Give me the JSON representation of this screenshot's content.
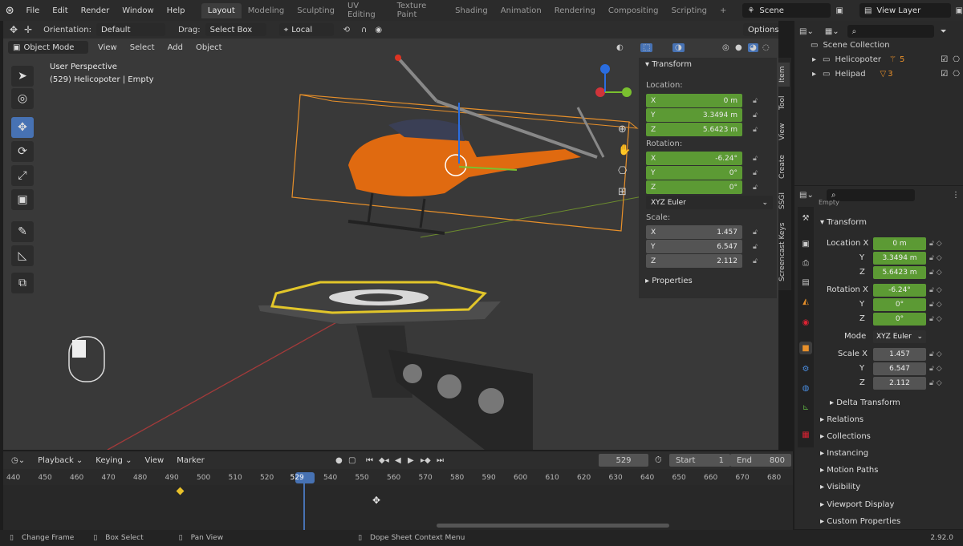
{
  "topbar": {
    "menus": [
      "File",
      "Edit",
      "Render",
      "Window",
      "Help"
    ],
    "workspaces": [
      "Layout",
      "Modeling",
      "Sculpting",
      "UV Editing",
      "Texture Paint",
      "Shading",
      "Animation",
      "Rendering",
      "Compositing",
      "Scripting"
    ],
    "add_tab": "+",
    "scene": "Scene",
    "view_layer": "View Layer"
  },
  "header": {
    "orientation_label": "Orientation:",
    "orientation_value": "Default",
    "drag_label": "Drag:",
    "drag_value": "Select Box",
    "pivot_value": "Local",
    "options": "Options",
    "mode": "Object Mode",
    "view_menus": [
      "View",
      "Select",
      "Add",
      "Object"
    ]
  },
  "viewport": {
    "perspective": "User Perspective",
    "object_info": "(529) Helicopoter | Empty"
  },
  "npanel": {
    "section": "Transform",
    "location_label": "Location:",
    "location": [
      {
        "axis": "X",
        "value": "0 m"
      },
      {
        "axis": "Y",
        "value": "3.3494 m"
      },
      {
        "axis": "Z",
        "value": "5.6423 m"
      }
    ],
    "rotation_label": "Rotation:",
    "rotation": [
      {
        "axis": "X",
        "value": "-6.24°"
      },
      {
        "axis": "Y",
        "value": "0°"
      },
      {
        "axis": "Z",
        "value": "0°"
      }
    ],
    "rotation_mode": "XYZ Euler",
    "scale_label": "Scale:",
    "scale": [
      {
        "axis": "X",
        "value": "1.457"
      },
      {
        "axis": "Y",
        "value": "6.547"
      },
      {
        "axis": "Z",
        "value": "2.112"
      }
    ],
    "properties": "Properties",
    "tabs": [
      "Item",
      "Tool",
      "View",
      "Create",
      "SSGI",
      "Screencast Keys"
    ]
  },
  "outliner": {
    "root": "Scene Collection",
    "items": [
      {
        "name": "Helicopoter",
        "badge": "5"
      },
      {
        "name": "Helipad",
        "badge": "3"
      }
    ]
  },
  "properties": {
    "obj_name": "Empty",
    "section": "Transform",
    "location_labels": [
      "Location X",
      "Y",
      "Z"
    ],
    "location_values": [
      "0 m",
      "3.3494 m",
      "5.6423 m"
    ],
    "rotation_labels": [
      "Rotation X",
      "Y",
      "Z"
    ],
    "rotation_values": [
      "-6.24°",
      "0°",
      "0°"
    ],
    "mode_label": "Mode",
    "mode_value": "XYZ Euler",
    "scale_labels": [
      "Scale X",
      "Y",
      "Z"
    ],
    "scale_values": [
      "1.457",
      "6.547",
      "2.112"
    ],
    "sub_sections": [
      "Delta Transform",
      "Relations",
      "Collections",
      "Instancing",
      "Motion Paths",
      "Visibility",
      "Viewport Display",
      "Custom Properties"
    ]
  },
  "timeline": {
    "menus": [
      "Playback",
      "Keying",
      "View",
      "Marker"
    ],
    "current_frame": "529",
    "start_label": "Start",
    "start_value": "1",
    "end_label": "End",
    "end_value": "800",
    "ticks": [
      "440",
      "450",
      "460",
      "470",
      "480",
      "490",
      "500",
      "510",
      "520",
      "529",
      "540",
      "550",
      "560",
      "570",
      "580",
      "590",
      "600",
      "610",
      "620",
      "630",
      "640",
      "650",
      "660",
      "670",
      "680"
    ]
  },
  "status": {
    "items": [
      "Change Frame",
      "Box Select",
      "Pan View",
      "Dope Sheet Context Menu"
    ],
    "version": "2.92.0"
  },
  "colors": {
    "accent": "#4772b3",
    "field_green": "#5c9a34",
    "bbox": "#e8902a",
    "heli_orange": "#e06a10"
  }
}
